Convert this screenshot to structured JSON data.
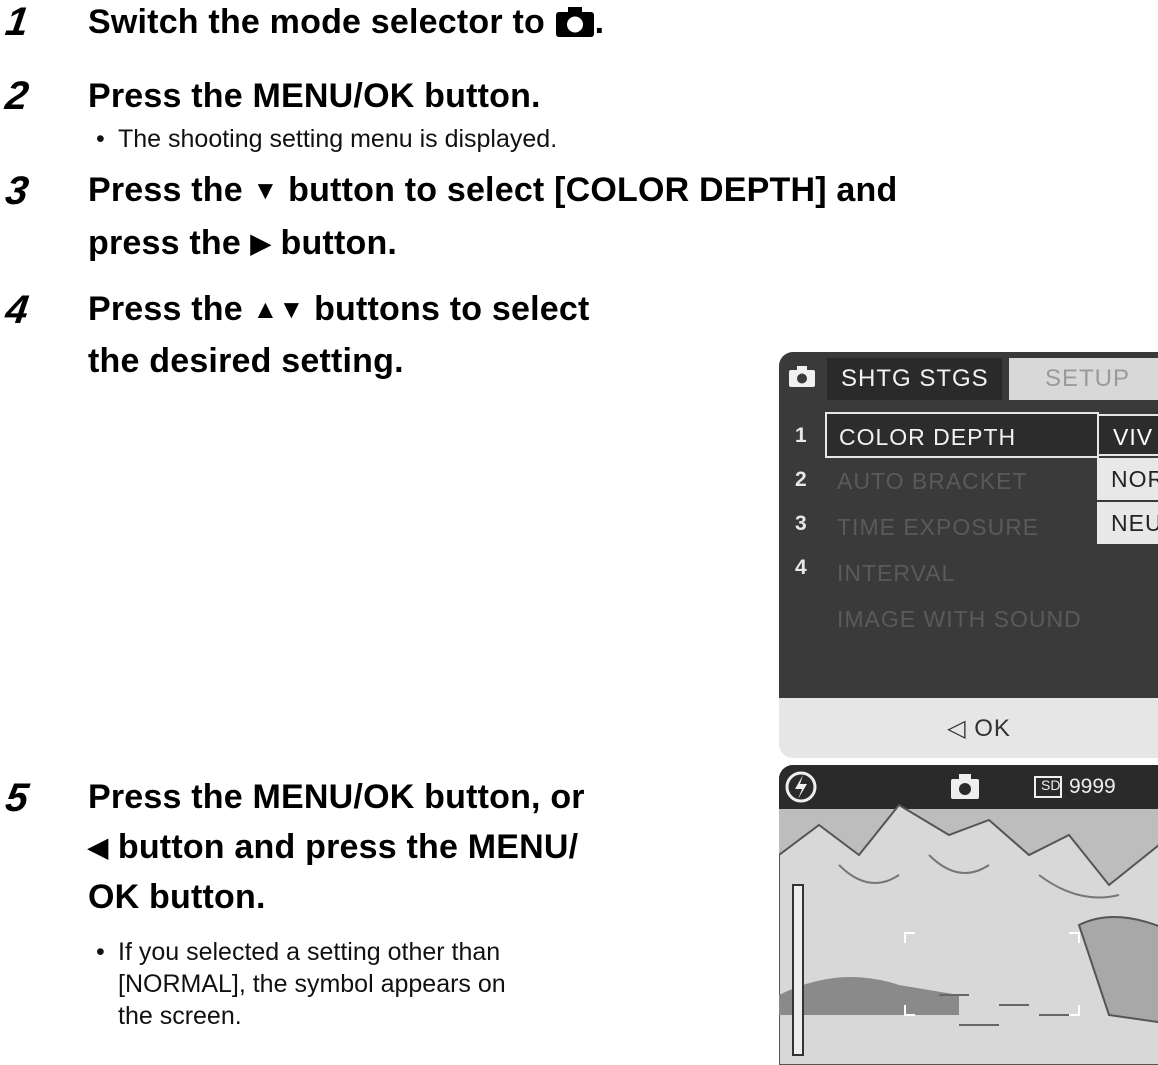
{
  "steps": [
    {
      "num": "1",
      "text": "Switch the mode selector to",
      "suffix": "."
    },
    {
      "num": "2",
      "text": "Press the MENU/OK button.",
      "bullet": "The shooting setting menu is displayed."
    },
    {
      "num": "3",
      "line1_a": "Press the",
      "line1_b": "button to select [COLOR DEPTH] and",
      "line2_a": "press the",
      "line2_b": "button."
    },
    {
      "num": "4",
      "line1_a": "Press the",
      "line1_b": "buttons to select",
      "line2": "the desired setting."
    },
    {
      "num": "5",
      "line1": "Press the MENU/OK button, or",
      "line2_b": "button and press the MENU/",
      "line3": "OK button.",
      "bullet_l1": "If you selected a setting other than",
      "bullet_l2": "[NORMAL], the symbol appears on",
      "bullet_l3": "the screen."
    }
  ],
  "glyphs": {
    "down": "▼",
    "right": "▶",
    "updown": "▲▼",
    "left": "◀",
    "bullet": "•"
  },
  "menu": {
    "tab_active": "SHTG STGS",
    "tab_inactive": "SETUP",
    "page_numbers": [
      "1",
      "2",
      "3",
      "4"
    ],
    "items": [
      {
        "label": "COLOR DEPTH",
        "selected": true
      },
      {
        "label": "AUTO BRACKET",
        "selected": false
      },
      {
        "label": "TIME EXPOSURE",
        "selected": false
      },
      {
        "label": "INTERVAL",
        "selected": false
      },
      {
        "label": "IMAGE WITH SOUND",
        "selected": false
      }
    ],
    "options": [
      "VIV",
      "NOR",
      "NEU"
    ],
    "footer": "◁ OK"
  },
  "preview": {
    "counter": "9999"
  }
}
